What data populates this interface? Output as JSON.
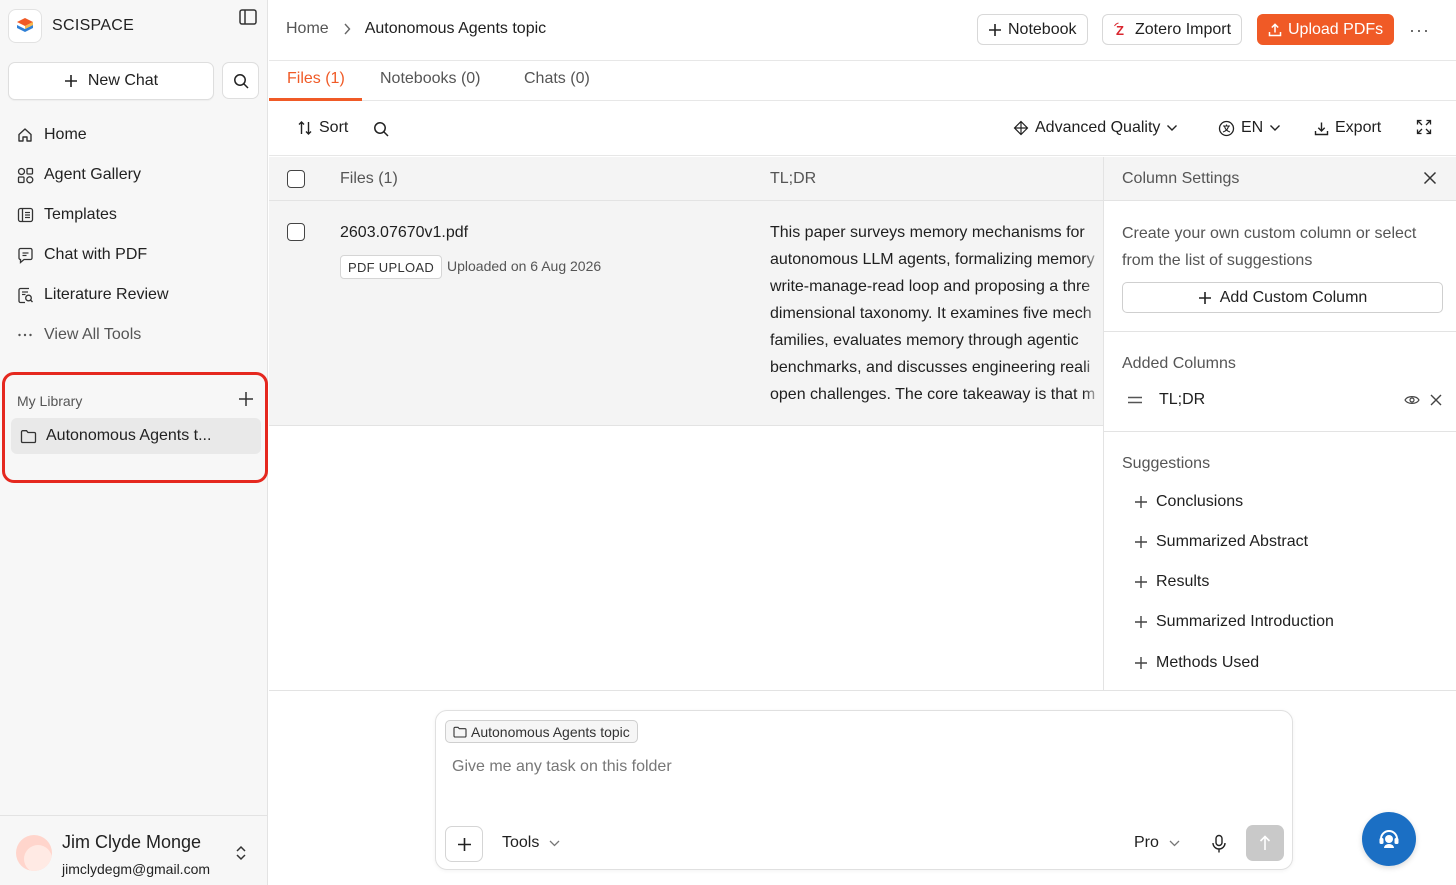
{
  "brand": {
    "name": "SCISPACE"
  },
  "sidebar": {
    "new_chat_label": "New Chat",
    "nav": [
      {
        "label": "Home",
        "icon": "home-icon"
      },
      {
        "label": "Agent Gallery",
        "icon": "agent-gallery-icon"
      },
      {
        "label": "Templates",
        "icon": "templates-icon"
      },
      {
        "label": "Chat with PDF",
        "icon": "chat-pdf-icon"
      },
      {
        "label": "Literature Review",
        "icon": "literature-review-icon"
      },
      {
        "label": "View All Tools",
        "icon": "ellipsis-icon"
      }
    ],
    "library": {
      "title": "My Library",
      "items": [
        {
          "label": "Autonomous Agents t...",
          "icon": "folder-icon"
        }
      ]
    },
    "user": {
      "name": "Jim Clyde Monge",
      "email": "jimclydegm@gmail.com"
    }
  },
  "header": {
    "breadcrumb": {
      "home": "Home",
      "current": "Autonomous Agents topic"
    },
    "buttons": {
      "notebook": "Notebook",
      "zotero": "Zotero Import",
      "upload": "Upload PDFs"
    }
  },
  "tabs": [
    {
      "label": "Files (1)",
      "active": true
    },
    {
      "label": "Notebooks (0)",
      "active": false
    },
    {
      "label": "Chats (0)",
      "active": false
    }
  ],
  "toolbar": {
    "sort_label": "Sort",
    "quality_label": "Advanced Quality",
    "language_label": "EN",
    "export_label": "Export"
  },
  "table": {
    "columns": {
      "files": "Files (1)",
      "tldr": "TL;DR"
    },
    "rows": [
      {
        "file_name": "2603.07670v1.pdf",
        "badge": "PDF UPLOAD",
        "uploaded": "Uploaded on 6 Aug 2026",
        "tldr_lines": [
          "This paper surveys memory mechanisms for",
          "autonomous LLM agents, formalizing memory",
          "write-manage-read loop and proposing a thre",
          "dimensional taxonomy. It examines five mech",
          "families, evaluates memory through agentic",
          "benchmarks, and discusses engineering reali",
          "open challenges. The core takeaway is that m"
        ]
      }
    ]
  },
  "column_settings": {
    "title": "Column Settings",
    "description": "Create your own custom column or select from the list of suggestions",
    "add_custom_label": "Add Custom Column",
    "added_title": "Added Columns",
    "added": [
      "TL;DR"
    ],
    "suggestions_title": "Suggestions",
    "suggestions": [
      "Conclusions",
      "Summarized Abstract",
      "Results",
      "Summarized Introduction",
      "Methods Used"
    ]
  },
  "composer": {
    "context_chip": "Autonomous Agents topic",
    "placeholder": "Give me any task on this folder",
    "tools_label": "Tools",
    "mode_label": "Pro"
  },
  "colors": {
    "accent": "#f05a26",
    "highlight_border": "#e5281f",
    "fab": "#1b6fc4"
  }
}
